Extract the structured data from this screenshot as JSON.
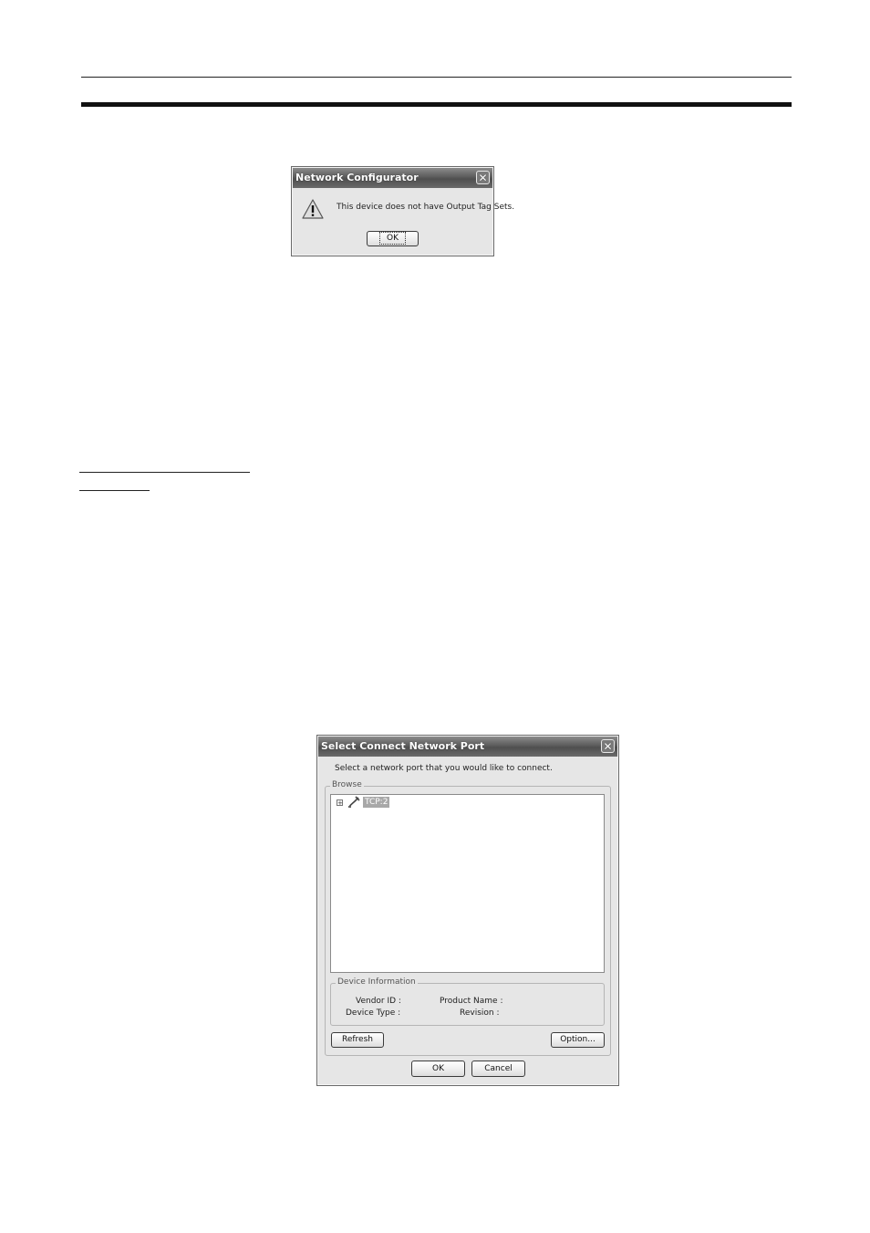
{
  "dialog1": {
    "title": "Network Configurator",
    "message": "This device does not have Output Tag Sets.",
    "ok_label": "OK",
    "icon": "warning-icon"
  },
  "dialog2": {
    "title": "Select Connect Network Port",
    "instruction": "Select a network port that you would like to connect.",
    "browse_label": "Browse",
    "tree": {
      "expander": "+",
      "item_label": "TCP:2"
    },
    "device_info": {
      "label": "Device Information",
      "vendor_id_label": "Vendor ID :",
      "device_type_label": "Device Type :",
      "product_name_label": "Product Name :",
      "revision_label": "Revision :"
    },
    "refresh_label": "Refresh",
    "option_label": "Option...",
    "ok_label": "OK",
    "cancel_label": "Cancel"
  },
  "colors": {
    "titlebar": "#5c5c5c",
    "window_bg": "#e6e6e6",
    "selection": "#a8a8a8"
  }
}
